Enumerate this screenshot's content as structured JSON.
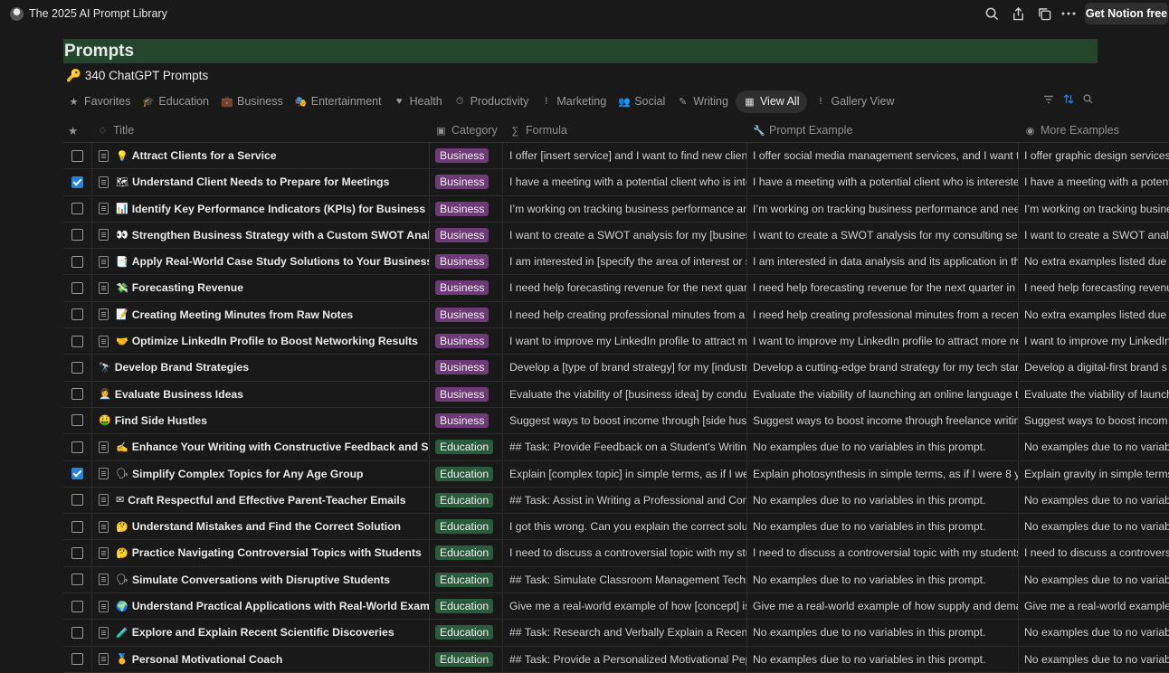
{
  "app": {
    "title": "The 2025 AI Prompt Library",
    "get_free_label": "Get Notion free",
    "icons": [
      "search-icon",
      "share-icon",
      "duplicate-icon",
      "more-icon"
    ]
  },
  "page": {
    "title": "Prompts",
    "subtitle": "340 ChatGPT Prompts",
    "subtitle_emoji": "🔑",
    "banner_color": "#24462b"
  },
  "tabs": [
    {
      "label": "Favorites",
      "icon": "★",
      "active": false
    },
    {
      "label": "Education",
      "icon": "🎓",
      "active": false
    },
    {
      "label": "Business",
      "icon": "💼",
      "active": false
    },
    {
      "label": "Entertainment",
      "icon": "🎭",
      "active": false
    },
    {
      "label": "Health",
      "icon": "♥",
      "active": false
    },
    {
      "label": "Productivity",
      "icon": "⏱",
      "active": false
    },
    {
      "label": "Marketing",
      "icon": "!",
      "active": false
    },
    {
      "label": "Social",
      "icon": "👥",
      "active": false
    },
    {
      "label": "Writing",
      "icon": "✎",
      "active": false
    },
    {
      "label": "View All",
      "icon": "▦",
      "active": true
    },
    {
      "label": "Gallery View",
      "icon": "!",
      "active": false
    }
  ],
  "columns": {
    "star": "★",
    "title": "Title",
    "category": "Category",
    "formula": "Formula",
    "prompt_example": "Prompt Example",
    "more_examples": "More Examples"
  },
  "colors": {
    "business_tag": "#6f3a78",
    "education_tag": "#2a5b3c",
    "checkbox_on": "#2383e2"
  },
  "rows": [
    {
      "checked": false,
      "doc": true,
      "emoji": "💡",
      "title": "Attract Clients for a Service",
      "category": "Business",
      "formula": "I offer [insert service] and I want to find new clients in",
      "example": "I offer social media management services, and I want to find",
      "more": "I offer graphic design services"
    },
    {
      "checked": true,
      "doc": true,
      "emoji": "🗺",
      "title": "Understand Client Needs to Prepare for Meetings",
      "category": "Business",
      "formula": "I have a meeting with a potential client who is interest",
      "example": "I have a meeting with a potential client who is interested in c",
      "more": "I have a meeting with a potent"
    },
    {
      "checked": false,
      "doc": true,
      "emoji": "📊",
      "title": "Identify Key Performance Indicators (KPIs) for Business Growth",
      "category": "Business",
      "formula": "I’m working on tracking business performance and ne",
      "example": "I’m working on tracking business performance and need hel",
      "more": "I’m working on tracking busine"
    },
    {
      "checked": false,
      "doc": true,
      "emoji": "👀",
      "title": "Strengthen Business Strategy with a Custom SWOT Analysis",
      "category": "Business",
      "formula": "I want to create a SWOT analysis for my [business/ser",
      "example": "I want to create a SWOT analysis for my consulting service i",
      "more": "I want to create a SWOT analy"
    },
    {
      "checked": false,
      "doc": true,
      "emoji": "📑",
      "title": "Apply Real-World Case Study Solutions to Your Business",
      "category": "Business",
      "formula": "I am interested in [specify the area of interest or skill",
      "example": "I am interested in data analysis and its application in the bus",
      "more": "No extra examples listed due t"
    },
    {
      "checked": false,
      "doc": true,
      "emoji": "💸",
      "title": "Forecasting Revenue",
      "category": "Business",
      "formula": "I need help forecasting revenue for the next quarter in",
      "example": "I need help forecasting revenue for the next quarter in my re",
      "more": "I need help forecasting revenu"
    },
    {
      "checked": false,
      "doc": true,
      "emoji": "📝",
      "title": "Creating Meeting Minutes from Raw Notes",
      "category": "Business",
      "formula": "I need help creating professional minutes from a rece",
      "example": "I need help creating professional minutes from a recent mee",
      "more": "No extra examples listed due t"
    },
    {
      "checked": false,
      "doc": true,
      "emoji": "🤝",
      "title": "Optimize LinkedIn Profile to Boost Networking Results",
      "category": "Business",
      "formula": "I want to improve my LinkedIn profile to attract more n",
      "example": "I want to improve my LinkedIn profile to attract more networ",
      "more": "I want to improve my LinkedIn"
    },
    {
      "checked": false,
      "doc": false,
      "emoji": "🔭",
      "title": "Develop Brand Strategies",
      "category": "Business",
      "formula": "Develop a [type of brand strategy] for my [industry] b",
      "example": "Develop a cutting-edge brand strategy for my tech startup l",
      "more": "Develop a digital-first brand s"
    },
    {
      "checked": false,
      "doc": false,
      "emoji": "👩‍💼",
      "title": "Evaluate Business Ideas",
      "category": "Business",
      "formula": "Evaluate the viability of [business idea] by conducting",
      "example": "Evaluate the viability of launching an online language tutorin",
      "more": "Evaluate the viability of launch"
    },
    {
      "checked": false,
      "doc": false,
      "emoji": "🤑",
      "title": "Find Side Hustles",
      "category": "Business",
      "formula": "Suggest ways to boost income through [side hustles]",
      "example": "Suggest ways to boost income through freelance writing co",
      "more": "Suggest ways to boost incom"
    },
    {
      "checked": false,
      "doc": true,
      "emoji": "✍",
      "title": "Enhance Your Writing with Constructive Feedback and Suggestions",
      "category": "Education",
      "formula": "## Task: Provide Feedback on a Student's Writing As",
      "example": "No examples due to no variables in this prompt.",
      "more": "No examples due to no variab"
    },
    {
      "checked": true,
      "doc": true,
      "emoji": "🗣",
      "title": "Simplify Complex Topics for Any Age Group",
      "category": "Education",
      "formula": "Explain [complex topic] in simple terms, as if I were [X",
      "example": "Explain photosynthesis in simple terms, as if I were 8 years o",
      "more": "Explain gravity in simple terms"
    },
    {
      "checked": false,
      "doc": true,
      "emoji": "✉",
      "title": "Craft Respectful and Effective Parent-Teacher Emails",
      "category": "Education",
      "formula": "## Task: Assist in Writing a Professional and Compass",
      "example": "No examples due to no variables in this prompt.",
      "more": "No examples due to no variab"
    },
    {
      "checked": false,
      "doc": true,
      "emoji": "🤔",
      "title": "Understand Mistakes and Find the Correct Solution",
      "category": "Education",
      "formula": "I got this wrong. Can you explain the correct solution",
      "example": "No examples due to no variables in this prompt.",
      "more": "No examples due to no variab"
    },
    {
      "checked": false,
      "doc": true,
      "emoji": "🤔",
      "title": "Practice Navigating Controversial Topics with Students",
      "category": "Education",
      "formula": "I need to discuss a controversial topic with my studen",
      "example": "I need to discuss a controversial topic with my students, spe",
      "more": "I need to discuss a controvers"
    },
    {
      "checked": false,
      "doc": true,
      "emoji": "🗣",
      "title": "Simulate Conversations with Disruptive Students",
      "category": "Education",
      "formula": "## Task: Simulate Classroom Management Technique",
      "example": "No examples due to no variables in this prompt.",
      "more": "No examples due to no variab"
    },
    {
      "checked": false,
      "doc": true,
      "emoji": "🌍",
      "title": "Understand Practical Applications with Real-World Examples",
      "category": "Education",
      "formula": "Give me a real-world example of how [concept] is app",
      "example": "Give me a real-world example of how supply and demand is",
      "more": "Give me a real-world example"
    },
    {
      "checked": false,
      "doc": true,
      "emoji": "🧪",
      "title": "Explore and Explain Recent Scientific Discoveries",
      "category": "Education",
      "formula": "## Task: Research and Verbally Explain a Recent Scie",
      "example": "No examples due to no variables in this prompt.",
      "more": "No examples due to no variab"
    },
    {
      "checked": false,
      "doc": true,
      "emoji": "🥇",
      "title": "Personal Motivational Coach",
      "category": "Education",
      "formula": "## Task: Provide a Personalized Motivational Pep Talk",
      "example": "No examples due to no variables in this prompt.",
      "more": "No examples due to no variab"
    }
  ]
}
